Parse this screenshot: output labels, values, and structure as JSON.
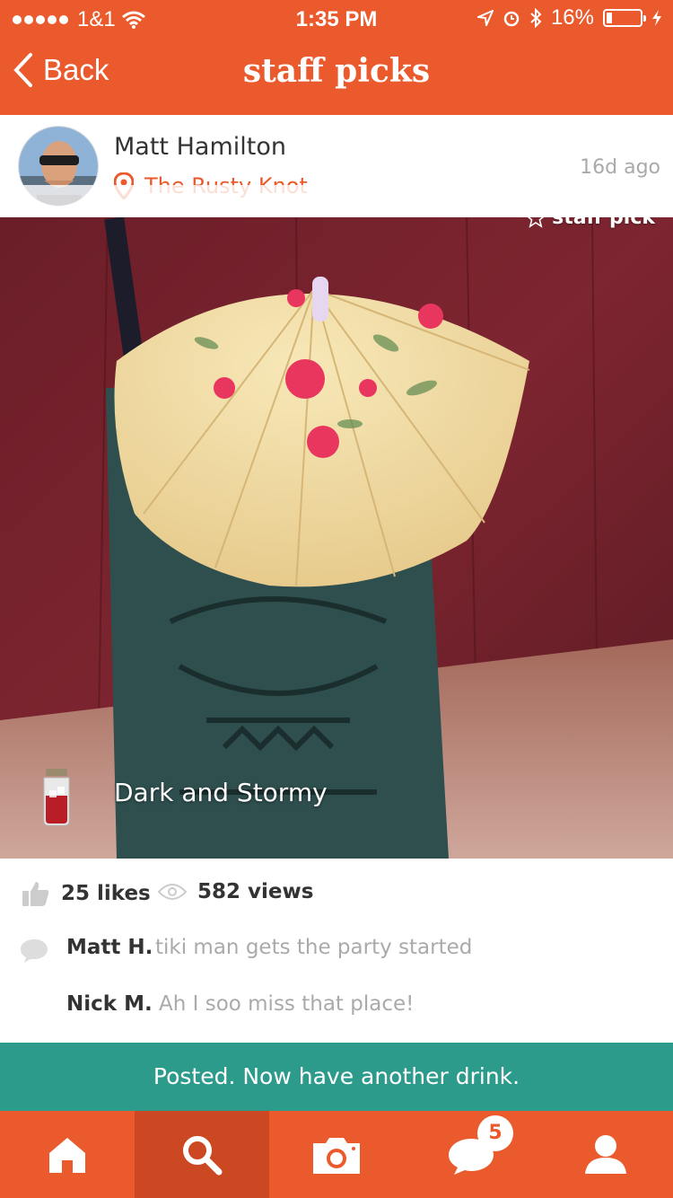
{
  "status_bar": {
    "carrier": "1&1",
    "time": "1:35 PM",
    "battery_percent": "16%",
    "battery_level": 0.16
  },
  "nav": {
    "back_label": "Back",
    "title": "staff picks"
  },
  "post": {
    "user_name": "Matt Hamilton",
    "venue": "The Rusty Knot",
    "time_ago": "16d ago",
    "badge": "staff pick",
    "drink_name": "Dark and Stormy",
    "likes": "25 likes",
    "views": "582 views"
  },
  "comments": [
    {
      "author": "Matt H.",
      "text": "tiki man gets the party started"
    },
    {
      "author": "Nick M.",
      "text": "Ah I soo miss that place!"
    }
  ],
  "toast": "Posted. Now have another drink.",
  "tabbar": {
    "tabs": [
      "home-icon",
      "search-icon",
      "camera-icon",
      "chat-icon",
      "profile-icon"
    ],
    "active": "search-icon",
    "chat_badge": "5"
  },
  "colors": {
    "brand": "#ea5a2c",
    "toast": "#2d9b8b",
    "active_tab": "#cc4822"
  }
}
